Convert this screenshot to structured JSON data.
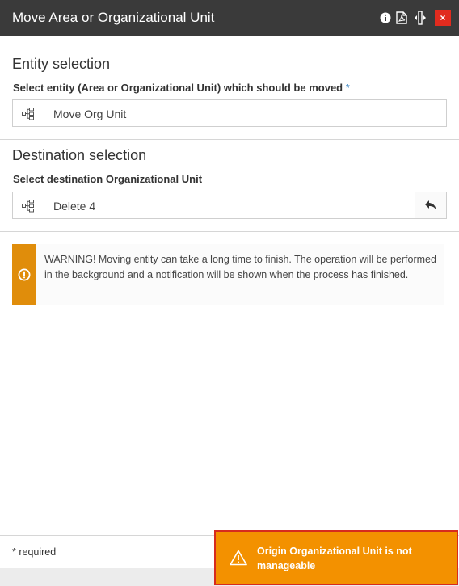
{
  "window": {
    "title": "Move Area or Organizational Unit",
    "close_glyph": "×",
    "icons": [
      "info-icon",
      "pdf-icon",
      "resize-icon",
      "close-icon"
    ]
  },
  "entity_section": {
    "title": "Entity selection",
    "label": "Select entity (Area or Organizational Unit) which should be moved",
    "required_marker": "*",
    "value": "Move Org Unit",
    "icon": "org-tree-icon"
  },
  "destination_section": {
    "title": "Destination selection",
    "label": "Select destination Organizational Unit",
    "value": "Delete 4",
    "icon": "org-tree-icon",
    "action_icon": "undo-arrow-icon"
  },
  "warning": {
    "icon": "exclamation-circle-icon",
    "text": "WARNING! Moving entity can take a long time to finish. The operation will be performed in the background and a notification will be shown when the process has finished."
  },
  "footer": {
    "required_note": "* required"
  },
  "toast": {
    "icon": "warning-triangle-icon",
    "message": "Origin Organizational Unit is not manageable"
  },
  "colors": {
    "titlebar": "#3a3a3a",
    "close_button": "#e12b1e",
    "warning_bar": "#e08d0b",
    "toast_bg": "#f39100",
    "toast_border": "#d62b1e",
    "required_star": "#2a7bbf"
  }
}
